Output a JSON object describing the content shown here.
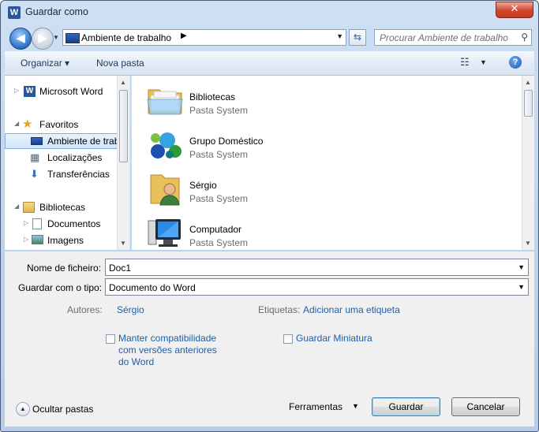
{
  "window": {
    "title": "Guardar como",
    "app_icon": "W",
    "close": "✕"
  },
  "nav": {
    "back": "◀",
    "forward": "▶",
    "address": {
      "location": "Ambiente de trabalho",
      "separator": "▶"
    },
    "search": {
      "placeholder": "Procurar Ambiente de trabalho"
    }
  },
  "toolbar": {
    "organize": "Organizar ▾",
    "new_folder": "Nova pasta",
    "help": "?"
  },
  "sidebar": {
    "items": [
      {
        "label": "Microsoft Word"
      },
      {
        "label": "Favoritos"
      },
      {
        "label": "Ambiente de trabalho"
      },
      {
        "label": "Localizações"
      },
      {
        "label": "Transferências"
      },
      {
        "label": "Bibliotecas"
      },
      {
        "label": "Documentos"
      },
      {
        "label": "Imagens"
      }
    ]
  },
  "files": [
    {
      "name": "Bibliotecas",
      "type": "Pasta System"
    },
    {
      "name": "Grupo Doméstico",
      "type": "Pasta System"
    },
    {
      "name": "Sérgio",
      "type": "Pasta System"
    },
    {
      "name": "Computador",
      "type": "Pasta System"
    }
  ],
  "form": {
    "filename_label": "Nome de ficheiro:",
    "filename_value": "Doc1",
    "type_label": "Guardar com o tipo:",
    "type_value": "Documento do Word",
    "authors_label": "Autores:",
    "authors_value": "Sérgio",
    "tags_label": "Etiquetas:",
    "tags_value": "Adicionar uma etiqueta",
    "compat_label": "Manter compatibilidade com versões anteriores do Word",
    "thumbnail_label": "Guardar Miniatura"
  },
  "footer": {
    "hide_folders": "Ocultar pastas",
    "tools": "Ferramentas",
    "save": "Guardar",
    "cancel": "Cancelar"
  }
}
